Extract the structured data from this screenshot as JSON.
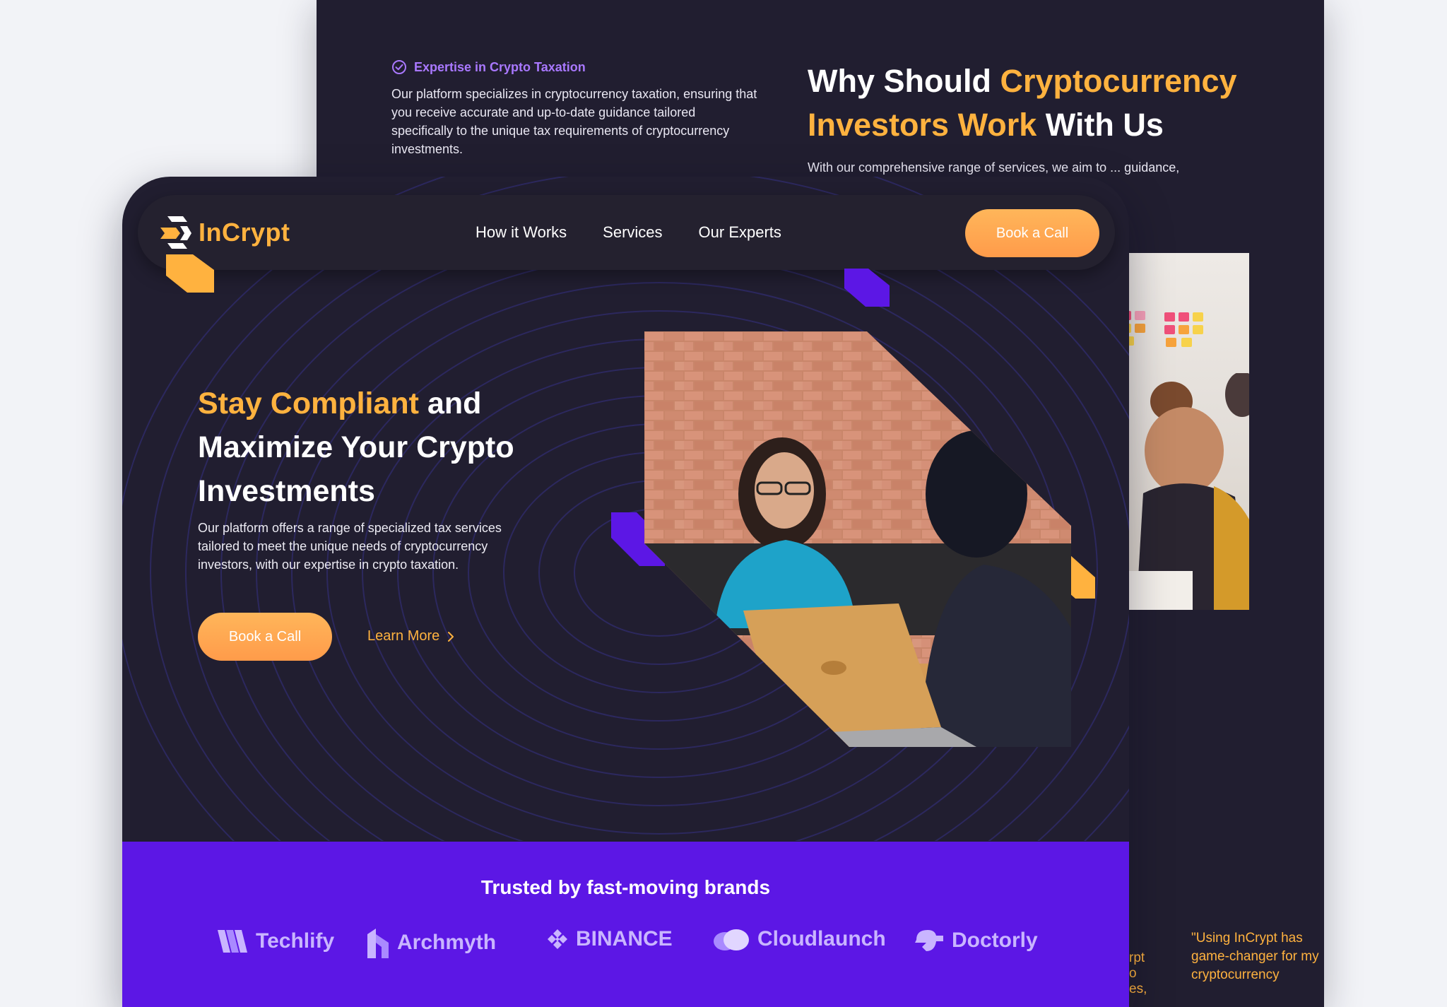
{
  "back_page": {
    "feature": {
      "title": "Expertise in Crypto Taxation",
      "body": "Our platform specializes in cryptocurrency taxation, ensuring that you receive accurate and up-to-date guidance tailored specifically to the unique tax requirements of cryptocurrency investments."
    },
    "why": {
      "title_part1": "Why Should ",
      "title_highlight": "Cryptocurrency Investors Work",
      "title_part2": " With Us",
      "body": "With our comprehensive range of services, we aim to ... guidance, and"
    },
    "testimonial_snippet": "\"Using InCrypt has game-changer for my cryptocurrency",
    "testimonial_left_fragments": [
      "rpt",
      "o",
      "es,"
    ]
  },
  "nav": {
    "logo_text": "InCrypt",
    "links": [
      "How it Works",
      "Services",
      "Our Experts"
    ],
    "cta": "Book a Call"
  },
  "hero": {
    "title_highlight": "Stay Compliant",
    "title_rest": " and Maximize Your Crypto Investments",
    "body": "Our platform offers a range of specialized tax services tailored to meet the unique needs of cryptocurrency investors, with our expertise in crypto taxation.",
    "cta": "Book a Call",
    "secondary": "Learn More"
  },
  "brands": {
    "title": "Trusted by fast-moving brands",
    "items": [
      {
        "name": "Techlify",
        "icon": "techlify-logo-icon"
      },
      {
        "name": "Archmyth",
        "icon": "archmyth-logo-icon"
      },
      {
        "name": "BINANCE",
        "icon": "binance-logo-icon"
      },
      {
        "name": "Cloudlaunch",
        "icon": "cloudlaunch-logo-icon"
      },
      {
        "name": "Doctorly",
        "icon": "doctorly-logo-icon"
      }
    ]
  },
  "colors": {
    "background": "#211e30",
    "accent_orange": "#ffb23f",
    "accent_purple": "#5c17e5",
    "soft_purple": "#a978ff"
  }
}
